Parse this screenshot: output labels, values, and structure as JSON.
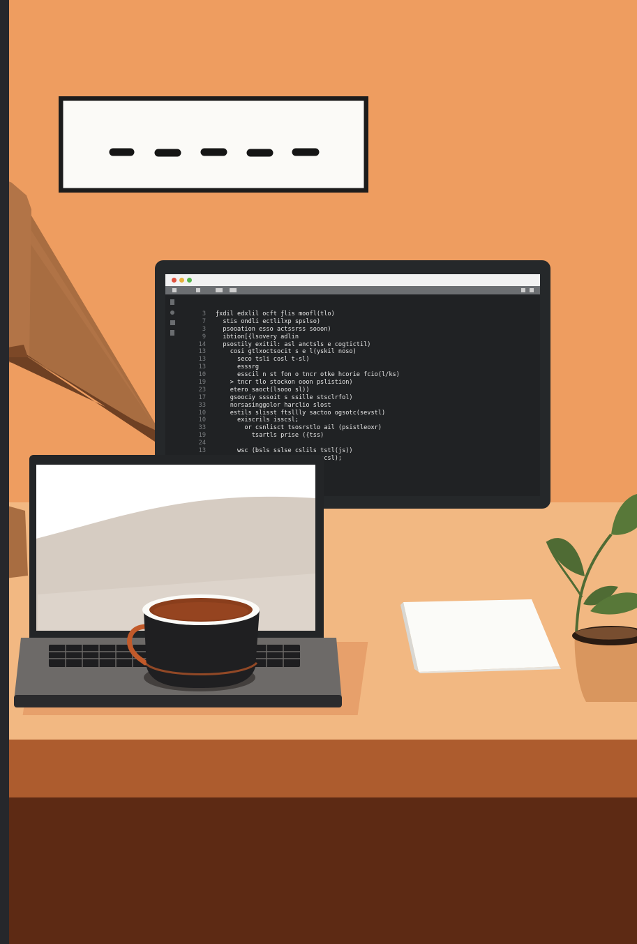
{
  "colors": {
    "wall": "#ee9d60",
    "left_strip": "#26272b",
    "desk_top": "#f2b882",
    "desk_front": "#ad5c2e",
    "floor": "#5d2a14",
    "monitor_frame": "#25282a",
    "code_bg": "#202224",
    "lamp_shade": "#a86d41",
    "lamp_band": "#6e4023",
    "plant_leaf": "#4f6b34",
    "pot": "#d9965e",
    "mug": "#1f1f21",
    "coffee": "#8a3e1c",
    "paper": "#fbfbf8"
  },
  "icons": [
    "sign-dashes",
    "lamp",
    "monitor",
    "laptop",
    "coffee-mug",
    "paper-sheet",
    "potted-plant"
  ],
  "monitor": {
    "window_dots": [
      "#e0523f",
      "#e6b23a",
      "#56b64c"
    ],
    "code_lines": [
      {
        "num": "3",
        "text": "ƒxdil edxlil ocft ƒlis moofl(tlo)"
      },
      {
        "num": "7",
        "text": "  stis ondli ectlilxp spslso)"
      },
      {
        "num": "3",
        "text": "  psooation esso actssrss sooon)"
      },
      {
        "num": "9",
        "text": "  ibtion[{lsovery adlin"
      },
      {
        "num": "14",
        "text": "  psostily exitil: asl anctsls e cogtictil)"
      },
      {
        "num": "13",
        "text": "    cosi gtlxoctsocit s e l(yskil noso)"
      },
      {
        "num": "13",
        "text": "      seco tsli cosl t-sl)"
      },
      {
        "num": "13",
        "text": "      esssrg"
      },
      {
        "num": "10",
        "text": "      esscil n st fon o tncr otke hcorie fcio(l/ks)"
      },
      {
        "num": "19",
        "text": "    > tncr tlo stockon ooon pslistion)"
      },
      {
        "num": "23",
        "text": "    etero saoct(lsooo sl))"
      },
      {
        "num": "17",
        "text": "    gsoociy sssoit s ssille stsclrfol)"
      },
      {
        "num": "33",
        "text": "    norsasinggolor harclio slost"
      },
      {
        "num": "10",
        "text": "    estils slisst ftsllly sactoo ogsotc(sevstl)"
      },
      {
        "num": "10",
        "text": "      exiscrils isscsl;"
      },
      {
        "num": "33",
        "text": "        or csnlisct tsosrstlo ail (psistleoxr)"
      },
      {
        "num": "19",
        "text": "          tsartls prise ({tss)"
      },
      {
        "num": "24",
        "text": ""
      },
      {
        "num": "13",
        "text": "      wsc (bsls sslse cslils tstl(js))"
      },
      {
        "num": "",
        "text": "                          sr scsl);"
      }
    ]
  }
}
